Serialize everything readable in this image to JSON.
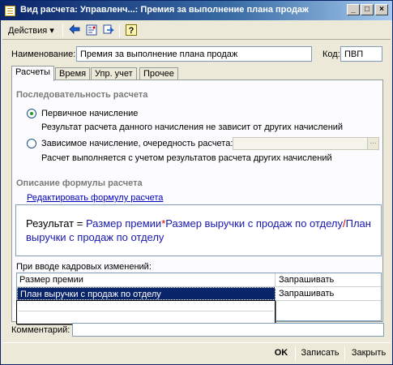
{
  "window": {
    "title": "Вид расчета: Управленч...: Премия за выполнение плана продаж",
    "minimize_symbol": "_",
    "maximize_symbol": "□",
    "close_symbol": "×"
  },
  "toolbar": {
    "actions_label": "Действия",
    "actions_arrow": "▾",
    "icons": [
      "go-back-icon",
      "structure-icon",
      "refresh-icon",
      "help-icon"
    ],
    "help_symbol": "?"
  },
  "form": {
    "name_label": "Наименование:",
    "name_value": "Премия за выполнение плана продаж",
    "code_label": "Код:",
    "code_value": "ПВП"
  },
  "tabs": [
    {
      "label": "Расчеты",
      "active": true
    },
    {
      "label": "Время",
      "active": false
    },
    {
      "label": "Упр. учет",
      "active": false
    },
    {
      "label": "Прочее",
      "active": false
    }
  ],
  "sequence": {
    "title": "Последовательность расчета",
    "option1_label": "Первичное начисление",
    "option1_desc": "Результат расчета данного начисления не зависит от других начислений",
    "option2_label": "Зависимое начисление, очередность расчета:",
    "option2_desc": "Расчет выполняется с учетом результатов расчета других начислений",
    "option2_button": "..."
  },
  "formula": {
    "title": "Описание формулы расчета",
    "edit_link": "Редактировать формулу расчета",
    "result_text": "Результат = ",
    "term1": "Размер премии",
    "op1": "*",
    "term2": "Размер выручки с продаж по отделу",
    "op2": "/",
    "term3": "План выручки с продаж по отделу"
  },
  "hr_changes": {
    "label": "При вводе кадровых изменений:",
    "rows": [
      {
        "name": "Размер премии",
        "value": "Запрашивать"
      },
      {
        "name": "План выручки с продаж по отделу",
        "value": "Запрашивать"
      }
    ]
  },
  "comment": {
    "label": "Комментарий:",
    "value": ""
  },
  "buttons": {
    "ok": "OK",
    "save": "Записать",
    "close": "Закрыть"
  },
  "colors": {
    "title_bar": "#0a246a",
    "link": "#0000c0",
    "formula_term": "#1818b0",
    "formula_operator": "#d40000",
    "selection": "#0a246a"
  }
}
